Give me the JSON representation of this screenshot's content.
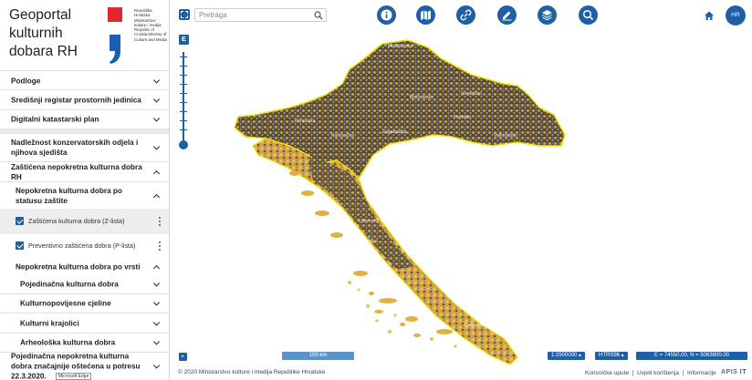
{
  "brand": {
    "title": "Geoportal kulturnih dobara RH",
    "ministry_text": "Republika Hrvatska Ministarstvo kulture i medija Republic of Croatia Ministry of Culture and Media"
  },
  "sidebar": {
    "sections": [
      {
        "label": "Podloge",
        "state": "collapsed"
      },
      {
        "label": "Središnji registar prostornih jedinica",
        "state": "collapsed"
      },
      {
        "label": "Digitalni katastarski plan",
        "state": "collapsed"
      },
      {
        "label": "Nadležnost konzervatorskih odjela i njihova sjedišta",
        "state": "collapsed"
      },
      {
        "label": "Zaštićena nepokretna kulturna dobra RH",
        "state": "expanded"
      }
    ],
    "sub_status": {
      "label": "Nepokretna kulturna dobra po statusu zaštite",
      "state": "expanded"
    },
    "layers": [
      {
        "label": "Zaštićena kulturna dobra  (Z-lista)",
        "checked": true
      },
      {
        "label": "Preventivno zaštićena dobra (P-lista)",
        "checked": true
      }
    ],
    "sub_type": {
      "label": "Nepokretna kulturna dobra po vrsti",
      "state": "expanded"
    },
    "types": [
      {
        "label": "Pojedinačna kulturna dobra"
      },
      {
        "label": "Kulturnopovijesne cjeline"
      },
      {
        "label": "Kulturni krajolici"
      },
      {
        "label": "Arheološka kulturna dobra"
      }
    ],
    "last_section": {
      "label": "Pojedinačna nepokretna kulturna dobra značajnije oštećena u potresu 22.3.2020."
    },
    "tooltip": "Microsoft Edge"
  },
  "toolbar": {
    "search_placeholder": "Pretraga",
    "language": "HR",
    "tools": [
      "info-icon",
      "map-icon",
      "link-icon",
      "edit-icon",
      "layers-icon",
      "search-icon"
    ]
  },
  "map": {
    "zoom_button_label": "E",
    "scale_bar_label": "100 km",
    "scale_select": "1:2500000",
    "projection_select": "HTRS96",
    "coordinates": "E = 74550.00, N = 5063800.00",
    "colors": {
      "accent": "#1f5fa8",
      "border": "#f2e500",
      "points_warm": "#e3a830",
      "points_blue": "#4a8fd8",
      "county_fill": "#4d4d4d"
    }
  },
  "footer": {
    "copyright": "© 2020 Ministarstvo kulture i medija Republike Hrvatske",
    "links": [
      "Korisničke upute",
      "Uvjeti korištenja",
      "Informacije"
    ],
    "vendor_a": "APIS",
    "vendor_b": "IT"
  }
}
